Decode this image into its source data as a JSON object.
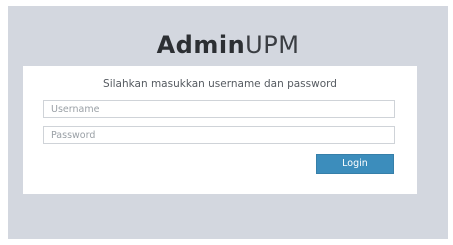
{
  "logo": {
    "bold_part": "Admin",
    "light_part": "UPM"
  },
  "login": {
    "message": "Silahkan masukkan username dan password",
    "username": {
      "value": "",
      "placeholder": "Username"
    },
    "password": {
      "value": "",
      "placeholder": "Password"
    },
    "button_label": "Login"
  },
  "colors": {
    "page_background": "#d3d7df",
    "box_background": "#ffffff",
    "button": "#3c8dbc"
  }
}
